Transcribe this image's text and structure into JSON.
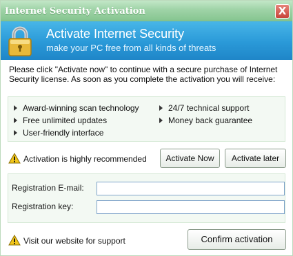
{
  "window": {
    "title": "Internet Security Activation",
    "close_symbol": "X"
  },
  "banner": {
    "headline": "Activate Internet Security",
    "subline": "make your PC free from all kinds of threats",
    "icon": "padlock-icon"
  },
  "intro": {
    "text": "Please click \"Activate now\" to continue with a secure purchase of Internet Security license. As soon as you complete the activation you will receive:"
  },
  "features": {
    "left": [
      "Award-winning scan technology",
      "Free unlimited updates",
      "User-friendly interface"
    ],
    "right": [
      "24/7 technical support",
      "Money back guarantee"
    ]
  },
  "recommendation": {
    "text": "Activation is highly recommended",
    "icon": "warning-icon",
    "activate_now_label": "Activate Now",
    "activate_later_label": "Activate later"
  },
  "registration": {
    "email_label": "Registration E-mail:",
    "email_value": "",
    "key_label": "Registration key:",
    "key_value": ""
  },
  "footer": {
    "support_text": "Visit our website for support",
    "confirm_label": "Confirm activation"
  },
  "colors": {
    "titlebar": "#9fd3a7",
    "banner": "#2a99d8",
    "close_button": "#c8443a",
    "warning": "#f2c61a"
  }
}
